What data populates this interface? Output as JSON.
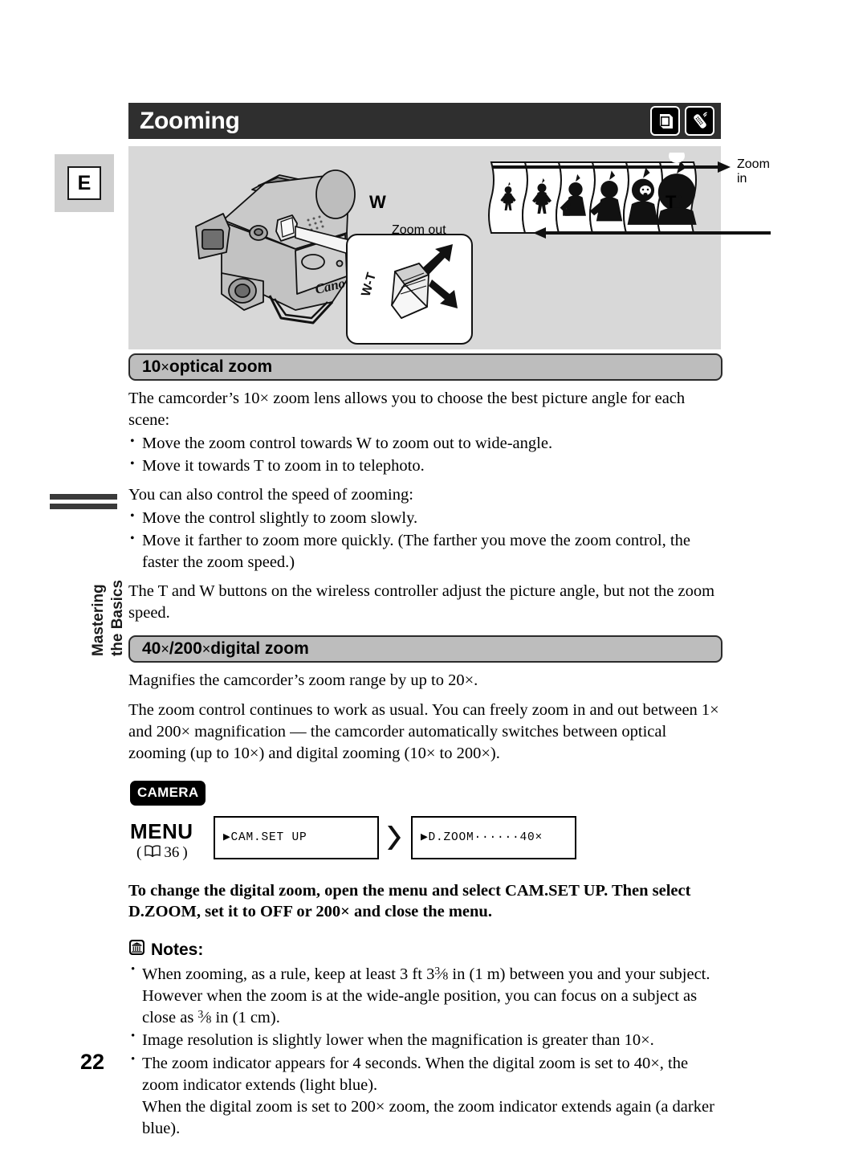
{
  "page": {
    "number": "22",
    "language_mark": "E",
    "side_tab_line1": "Mastering",
    "side_tab_line2": "the Basics"
  },
  "header": {
    "title": "Zooming",
    "icons": [
      {
        "name": "tape-cassette-icon",
        "label": "Tape"
      },
      {
        "name": "wireless-controller-icon",
        "label": "Wireless controller"
      }
    ]
  },
  "illustration": {
    "zoom_in_label": "Zoom in",
    "zoom_out_label": "Zoom out",
    "wide_letter": "W",
    "tele_letter": "T",
    "brand": "Canon",
    "rocker_label": "W-T",
    "frame_count": 6
  },
  "sections": [
    {
      "heading_prefix": "10",
      "heading_mult": "×",
      "heading_rest": " optical zoom",
      "paragraphs": [
        "The camcorder’s 10× zoom lens allows you to choose the best picture angle for each scene:"
      ],
      "bullets_1": [
        "Move the zoom control towards W to zoom out to wide-angle.",
        "Move it towards T to zoom in to telephoto."
      ],
      "paragraph_2": "You can also control the speed of zooming:",
      "bullets_2": [
        "Move the control slightly to zoom slowly.",
        "Move it farther to zoom more quickly. (The farther you move the zoom control, the faster the zoom speed.)"
      ],
      "paragraph_3": "The T and W buttons on the wireless controller adjust the picture angle, but not the zoom speed."
    },
    {
      "heading_prefix": "40",
      "heading_mult": "×",
      "heading_mid": "/200",
      "heading_mult2": "×",
      "heading_rest": " digital zoom",
      "paragraphs": [
        "Magnifies the camcorder’s zoom range by up to 20×.",
        "The zoom control continues to work as usual. You can freely zoom in and out between 1× and 200× magnification — the camcorder automatically switches between optical zooming (up to 10×) and digital zooming (10× to 200×)."
      ]
    }
  ],
  "menu_flow": {
    "mode_badge": "CAMERA",
    "menu_label": "MENU",
    "reference_open": "(",
    "reference_page": "36",
    "reference_close": ")",
    "step1": "▶CAM.SET UP",
    "step2": "▶D.ZOOM······40×"
  },
  "instruction": "To change the digital zoom, open the menu and select CAM.SET UP. Then select D.ZOOM, set it to OFF or 200× and close the menu.",
  "notes": {
    "heading": "Notes:",
    "items": [
      "When zooming, as a rule, keep at least 3 ft 3⅜ in (1 m) between you and your subject. However when the zoom is at the wide-angle position, you can focus on a subject as close as ⅜ in (1 cm).",
      "Image resolution is slightly lower when the magnification is greater than 10×.",
      "The zoom indicator appears for 4 seconds. When the digital zoom is set to 40×, the zoom indicator extends (light blue).\nWhen the digital zoom is set to 200× zoom, the zoom indicator extends again (a darker blue)."
    ]
  },
  "colors": {
    "header_bg": "#2f2f2f",
    "panel_bg": "#d8d8d8",
    "section_head_bg": "#bdbdbd",
    "badge_bg": "#000000"
  }
}
